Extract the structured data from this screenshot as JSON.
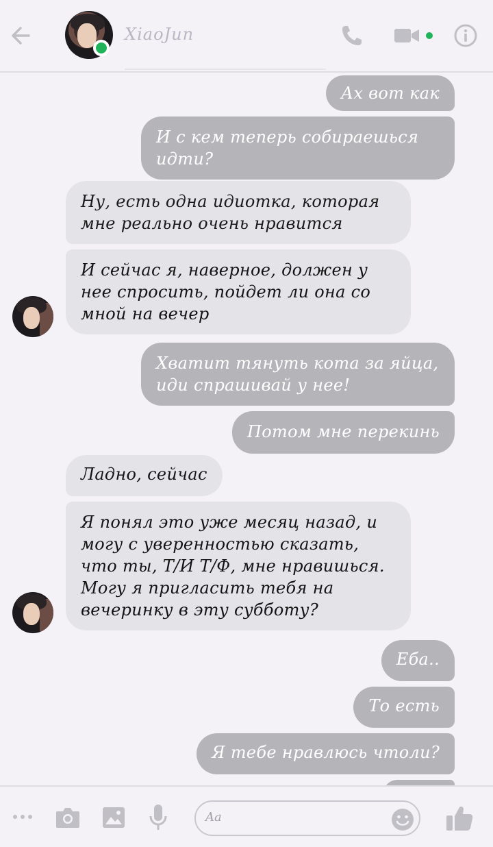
{
  "header": {
    "contact_name": "XiaoJun",
    "online": true,
    "icons": [
      "back-arrow-icon",
      "phone-icon",
      "video-camera-icon",
      "info-icon"
    ],
    "accent_color": "#1fb45a"
  },
  "messages": [
    {
      "dir": "out",
      "text": "Ах вот как"
    },
    {
      "dir": "out",
      "text": "И с кем теперь собираешься идти?"
    },
    {
      "dir": "in",
      "text": "Ну, есть одна идиотка, которая мне реально очень нравится"
    },
    {
      "dir": "in",
      "text": "И сейчас я, наверное, должен у нее спросить, пойдет ли она со мной на вечер"
    },
    {
      "dir": "out",
      "text": "Хватит тянуть кота за яйца, иди спрашивай у нее!"
    },
    {
      "dir": "out",
      "text": "Потом мне перекинь"
    },
    {
      "dir": "in",
      "text": "Ладно, сейчас"
    },
    {
      "dir": "in",
      "text": "Я понял это уже месяц назад, и могу с уверенностью сказать, что ты, Т/И Т/Ф, мне нравишься. Могу я пригласить тебя на вечеринку в эту субботу?"
    },
    {
      "dir": "out",
      "text": "Еба.."
    },
    {
      "dir": "out",
      "text": "То есть"
    },
    {
      "dir": "out",
      "text": "Я тебе нравлюсь чтоли?"
    }
  ],
  "composer": {
    "placeholder": "Aa",
    "icons": [
      "more-icon",
      "camera-icon",
      "gallery-icon",
      "microphone-icon",
      "emoji-icon",
      "thumbs-up-icon"
    ]
  },
  "colors": {
    "outgoing_bubble": "#b5b4b8",
    "incoming_bubble": "#e4e3e8",
    "background": "#f4f2f7"
  }
}
